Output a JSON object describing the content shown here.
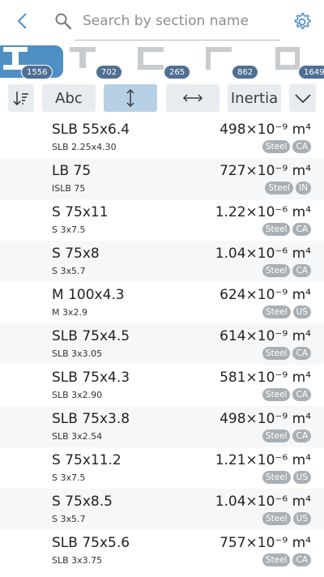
{
  "search": {
    "placeholder": "Search by section name",
    "value": ""
  },
  "shapes": [
    {
      "icon": "i-beam-icon",
      "count": "1556",
      "active": true
    },
    {
      "icon": "t-section-icon",
      "count": "702",
      "active": false
    },
    {
      "icon": "channel-icon",
      "count": "265",
      "active": false
    },
    {
      "icon": "angle-icon",
      "count": "862",
      "active": false
    },
    {
      "icon": "hollow-section-icon",
      "count": "1649",
      "active": false
    }
  ],
  "toolbar": {
    "abc_label": "Abc",
    "property_label": "Inertia"
  },
  "colors": {
    "accent": "#4e8fc4",
    "selected_toggle": "#b8d0e6",
    "badge": "#4f6f94",
    "tag": "#a9b0b5"
  },
  "rows": [
    {
      "name": "SLB 55x6.4",
      "alias": "SLB 2.25x4.30",
      "value": "498×10⁻⁹ m⁴",
      "material": "Steel",
      "country": "CA"
    },
    {
      "name": "LB 75",
      "alias": "ISLB 75",
      "value": "727×10⁻⁹ m⁴",
      "material": "Steel",
      "country": "IN"
    },
    {
      "name": "S 75x11",
      "alias": "S 3x7.5",
      "value": "1.22×10⁻⁶ m⁴",
      "material": "Steel",
      "country": "CA"
    },
    {
      "name": "S 75x8",
      "alias": "S 3x5.7",
      "value": "1.04×10⁻⁶ m⁴",
      "material": "Steel",
      "country": "CA"
    },
    {
      "name": "M 100x4.3",
      "alias": "M 3x2.9",
      "value": "624×10⁻⁹ m⁴",
      "material": "Steel",
      "country": "US"
    },
    {
      "name": "SLB 75x4.5",
      "alias": "SLB 3x3.05",
      "value": "614×10⁻⁹ m⁴",
      "material": "Steel",
      "country": "CA"
    },
    {
      "name": "SLB 75x4.3",
      "alias": "SLB 3x2.90",
      "value": "581×10⁻⁹ m⁴",
      "material": "Steel",
      "country": "CA"
    },
    {
      "name": "SLB 75x3.8",
      "alias": "SLB 3x2.54",
      "value": "498×10⁻⁹ m⁴",
      "material": "Steel",
      "country": "CA"
    },
    {
      "name": "S 75x11.2",
      "alias": "S 3x7.5",
      "value": "1.21×10⁻⁶ m⁴",
      "material": "Steel",
      "country": "US"
    },
    {
      "name": "S 75x8.5",
      "alias": "S 3x5.7",
      "value": "1.04×10⁻⁶ m⁴",
      "material": "Steel",
      "country": "US"
    },
    {
      "name": "SLB 75x5.6",
      "alias": "SLB 3x3.75",
      "value": "757×10⁻⁹ m⁴",
      "material": "Steel",
      "country": "CA"
    }
  ]
}
